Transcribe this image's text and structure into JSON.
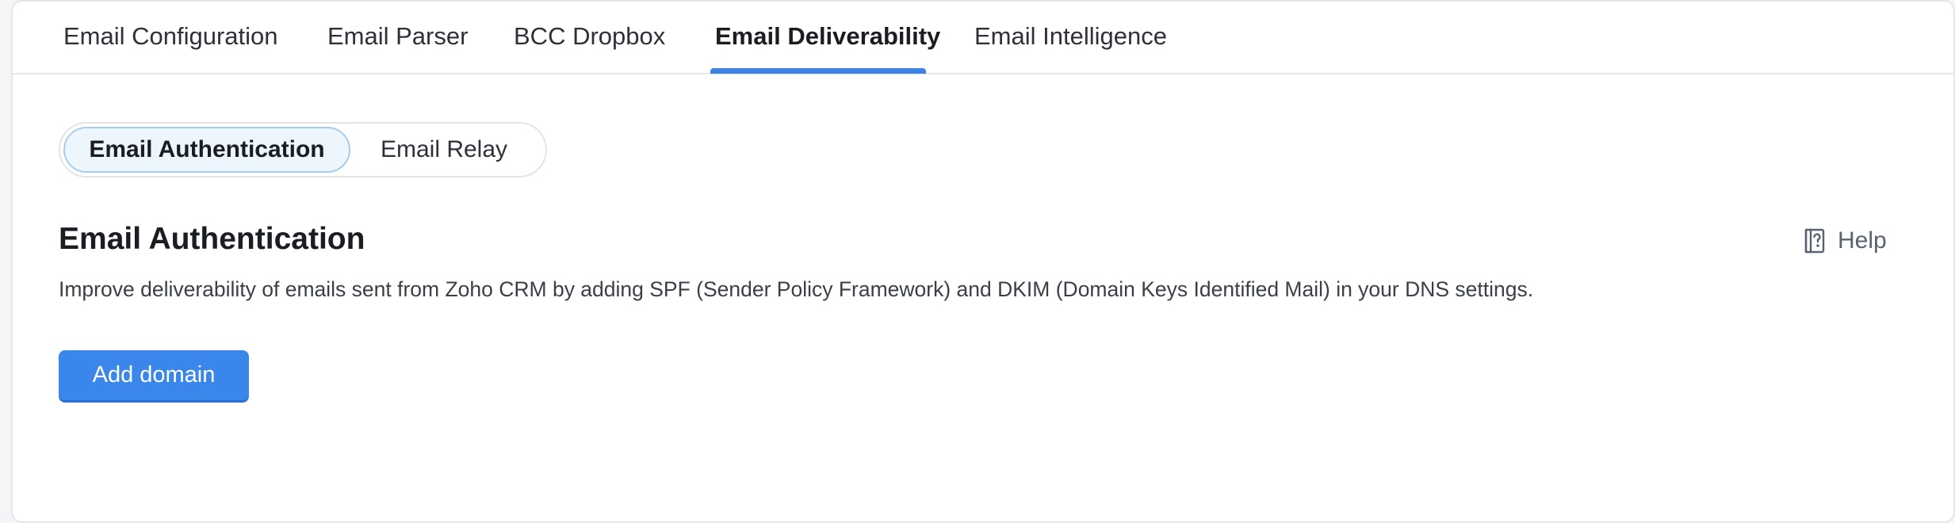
{
  "top_tabs": {
    "items": [
      {
        "label": "Email Configuration"
      },
      {
        "label": "Email Parser"
      },
      {
        "label": "BCC Dropbox"
      },
      {
        "label": "Email Deliverability"
      },
      {
        "label": "Email Intelligence"
      }
    ],
    "active": "Email Deliverability"
  },
  "sub_tabs": {
    "items": [
      {
        "label": "Email Authentication"
      },
      {
        "label": "Email Relay"
      }
    ],
    "active": "Email Authentication"
  },
  "section": {
    "title": "Email Authentication",
    "help_label": "Help",
    "description": "Improve deliverability of emails sent from Zoho CRM by adding SPF (Sender Policy Framework) and DKIM (Domain Keys Identified Mail) in your DNS settings.",
    "add_button_label": "Add domain"
  },
  "colors": {
    "accent": "#3b86ea",
    "active_tab_underline": "#3f82e6",
    "sub_tab_active_bg": "#eef6fd"
  },
  "icons": {
    "help": "help-book-icon"
  }
}
